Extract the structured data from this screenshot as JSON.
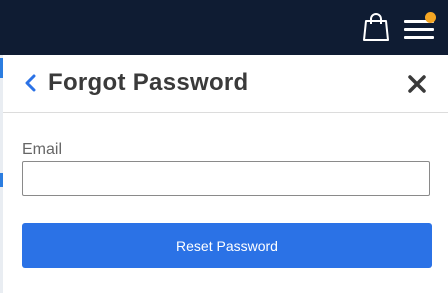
{
  "topbar": {
    "bag_icon": "shopping-bag-icon",
    "menu_icon": "hamburger-menu-icon",
    "notification_color": "#f5a623",
    "background_color": "#0f1c33"
  },
  "panel": {
    "title": "Forgot Password",
    "back_icon": "chevron-left-icon",
    "close_icon": "close-icon"
  },
  "form": {
    "email_label": "Email",
    "email_value": "",
    "email_placeholder": "",
    "submit_label": "Reset Password",
    "accent_color": "#2b72e6"
  }
}
